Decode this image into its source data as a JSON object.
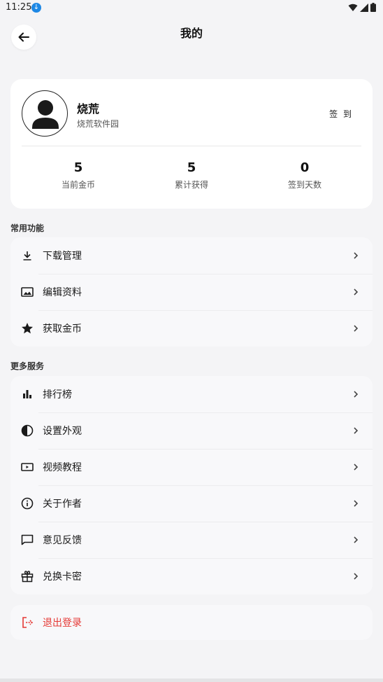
{
  "status_bar": {
    "time": "11:25"
  },
  "header": {
    "title": "我的"
  },
  "profile": {
    "name": "烧荒",
    "subtitle": "烧荒软件园",
    "checkin_label": "签 到",
    "stats": [
      {
        "value": "5",
        "label": "当前金币"
      },
      {
        "value": "5",
        "label": "累计获得"
      },
      {
        "value": "0",
        "label": "签到天数"
      }
    ]
  },
  "common": {
    "title": "常用功能",
    "items": [
      {
        "label": "下载管理",
        "icon": "download-icon"
      },
      {
        "label": "编辑资料",
        "icon": "edit-image-icon"
      },
      {
        "label": "获取金币",
        "icon": "star-icon"
      }
    ]
  },
  "more": {
    "title": "更多服务",
    "items": [
      {
        "label": "排行榜",
        "icon": "leaderboard-icon"
      },
      {
        "label": "设置外观",
        "icon": "contrast-icon"
      },
      {
        "label": "视频教程",
        "icon": "video-icon"
      },
      {
        "label": "关于作者",
        "icon": "info-icon"
      },
      {
        "label": "意见反馈",
        "icon": "feedback-icon"
      },
      {
        "label": "兑换卡密",
        "icon": "gift-icon"
      }
    ]
  },
  "logout": {
    "label": "退出登录",
    "icon": "logout-icon"
  },
  "colors": {
    "danger": "#e53935",
    "card": "#ffffff",
    "background": "#f4f4f6"
  }
}
